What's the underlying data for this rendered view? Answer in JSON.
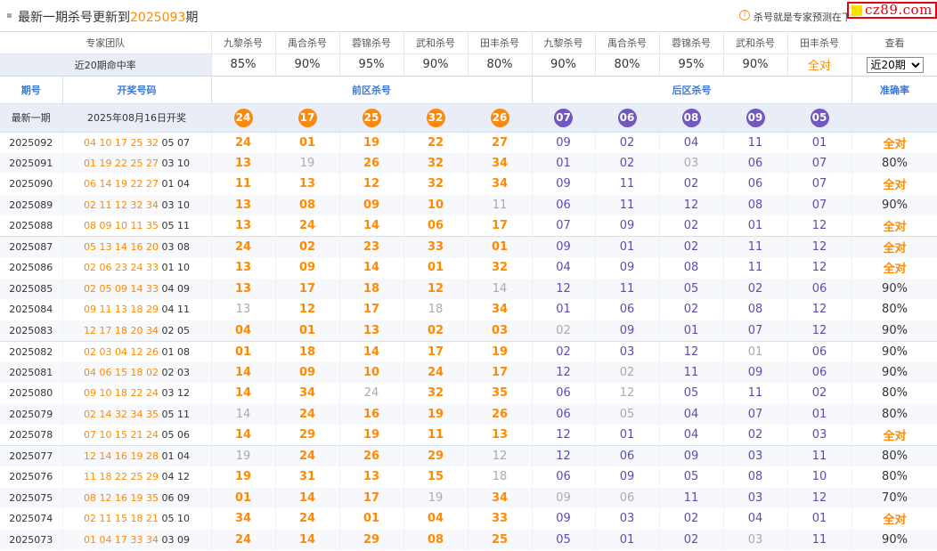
{
  "header": {
    "title_prefix": "最新一期杀号更新到",
    "title_issue": "2025093",
    "title_suffix": "期",
    "help_icon": "question-circle-icon",
    "note": "杀号就是专家预测在下",
    "logo": "cz89.com"
  },
  "experts": [
    "九黎杀号",
    "禹合杀号",
    "蓉锦杀号",
    "武和杀号",
    "田丰杀号",
    "九黎杀号",
    "禹合杀号",
    "蓉锦杀号",
    "武和杀号",
    "田丰杀号"
  ],
  "labels": {
    "team": "专家团队",
    "view": "查看",
    "rate_label": "近20期命中率",
    "col_issue": "期号",
    "col_draw": "开奖号码",
    "col_front": "前区杀号",
    "col_back": "后区杀号",
    "col_acc": "准确率"
  },
  "rates": [
    "85%",
    "90%",
    "95%",
    "90%",
    "80%",
    "90%",
    "80%",
    "95%",
    "90%",
    "全对"
  ],
  "period_select": {
    "selected": "近20期",
    "options": [
      "近20期"
    ]
  },
  "latest": {
    "issue": "最新一期",
    "draw_text": "2025年08月16日开奖",
    "front": [
      "24",
      "17",
      "25",
      "32",
      "26"
    ],
    "back": [
      "07",
      "06",
      "08",
      "09",
      "05"
    ]
  },
  "rows": [
    {
      "issue": "2025092",
      "draw_front": "04 10 17 25 32",
      "draw_back": "05 07",
      "kills": [
        "24",
        "01",
        "19",
        "22",
        "27",
        "09",
        "02",
        "04",
        "11",
        "01"
      ],
      "miss": [
        false,
        false,
        false,
        false,
        false,
        false,
        false,
        false,
        false,
        false
      ],
      "acc": "全对"
    },
    {
      "issue": "2025091",
      "draw_front": "01 19 22 25 27",
      "draw_back": "03 10",
      "kills": [
        "13",
        "19",
        "26",
        "32",
        "34",
        "01",
        "02",
        "03",
        "06",
        "07"
      ],
      "miss": [
        false,
        true,
        false,
        false,
        false,
        false,
        false,
        true,
        false,
        false
      ],
      "acc": "80%"
    },
    {
      "issue": "2025090",
      "draw_front": "06 14 19 22 27",
      "draw_back": "01 04",
      "kills": [
        "11",
        "13",
        "12",
        "32",
        "34",
        "09",
        "11",
        "02",
        "06",
        "07"
      ],
      "miss": [
        false,
        false,
        false,
        false,
        false,
        false,
        false,
        false,
        false,
        false
      ],
      "acc": "全对"
    },
    {
      "issue": "2025089",
      "draw_front": "02 11 12 32 34",
      "draw_back": "03 10",
      "kills": [
        "13",
        "08",
        "09",
        "10",
        "11",
        "06",
        "11",
        "12",
        "08",
        "07"
      ],
      "miss": [
        false,
        false,
        false,
        false,
        true,
        false,
        false,
        false,
        false,
        false
      ],
      "acc": "90%"
    },
    {
      "issue": "2025088",
      "draw_front": "08 09 10 11 35",
      "draw_back": "05 11",
      "kills": [
        "13",
        "24",
        "14",
        "06",
        "17",
        "07",
        "09",
        "02",
        "01",
        "12"
      ],
      "miss": [
        false,
        false,
        false,
        false,
        false,
        false,
        false,
        false,
        false,
        false
      ],
      "acc": "全对"
    },
    {
      "issue": "2025087",
      "draw_front": "05 13 14 16 20",
      "draw_back": "03 08",
      "kills": [
        "24",
        "02",
        "23",
        "33",
        "01",
        "09",
        "01",
        "02",
        "11",
        "12"
      ],
      "miss": [
        false,
        false,
        false,
        false,
        false,
        false,
        false,
        false,
        false,
        false
      ],
      "acc": "全对"
    },
    {
      "issue": "2025086",
      "draw_front": "02 06 23 24 33",
      "draw_back": "01 10",
      "kills": [
        "13",
        "09",
        "14",
        "01",
        "32",
        "04",
        "09",
        "08",
        "11",
        "12"
      ],
      "miss": [
        false,
        false,
        false,
        false,
        false,
        false,
        false,
        false,
        false,
        false
      ],
      "acc": "全对"
    },
    {
      "issue": "2025085",
      "draw_front": "02 05 09 14 33",
      "draw_back": "04 09",
      "kills": [
        "13",
        "17",
        "18",
        "12",
        "14",
        "12",
        "11",
        "05",
        "02",
        "06"
      ],
      "miss": [
        false,
        false,
        false,
        false,
        true,
        false,
        false,
        false,
        false,
        false
      ],
      "acc": "90%"
    },
    {
      "issue": "2025084",
      "draw_front": "09 11 13 18 29",
      "draw_back": "04 11",
      "kills": [
        "13",
        "12",
        "17",
        "18",
        "34",
        "01",
        "06",
        "02",
        "08",
        "12"
      ],
      "miss": [
        true,
        false,
        false,
        true,
        false,
        false,
        false,
        false,
        false,
        false
      ],
      "acc": "80%"
    },
    {
      "issue": "2025083",
      "draw_front": "12 17 18 20 34",
      "draw_back": "02 05",
      "kills": [
        "04",
        "01",
        "13",
        "02",
        "03",
        "02",
        "09",
        "01",
        "07",
        "12"
      ],
      "miss": [
        false,
        false,
        false,
        false,
        false,
        true,
        false,
        false,
        false,
        false
      ],
      "acc": "90%"
    },
    {
      "issue": "2025082",
      "draw_front": "02 03 04 12 26",
      "draw_back": "01 08",
      "kills": [
        "01",
        "18",
        "14",
        "17",
        "19",
        "02",
        "03",
        "12",
        "01",
        "06"
      ],
      "miss": [
        false,
        false,
        false,
        false,
        false,
        false,
        false,
        false,
        true,
        false
      ],
      "acc": "90%"
    },
    {
      "issue": "2025081",
      "draw_front": "04 06 15 18 02",
      "draw_back": "02 03",
      "kills": [
        "14",
        "09",
        "10",
        "24",
        "17",
        "12",
        "02",
        "11",
        "09",
        "06"
      ],
      "miss": [
        false,
        false,
        false,
        false,
        false,
        false,
        true,
        false,
        false,
        false
      ],
      "acc": "90%"
    },
    {
      "issue": "2025080",
      "draw_front": "09 10 18 22 24",
      "draw_back": "03 12",
      "kills": [
        "14",
        "34",
        "24",
        "32",
        "35",
        "06",
        "12",
        "05",
        "11",
        "02"
      ],
      "miss": [
        false,
        false,
        true,
        false,
        false,
        false,
        true,
        false,
        false,
        false
      ],
      "acc": "80%"
    },
    {
      "issue": "2025079",
      "draw_front": "02 14 32 34 35",
      "draw_back": "05 11",
      "kills": [
        "14",
        "24",
        "16",
        "19",
        "26",
        "06",
        "05",
        "04",
        "07",
        "01"
      ],
      "miss": [
        true,
        false,
        false,
        false,
        false,
        false,
        true,
        false,
        false,
        false
      ],
      "acc": "80%"
    },
    {
      "issue": "2025078",
      "draw_front": "07 10 15 21 24",
      "draw_back": "05 06",
      "kills": [
        "14",
        "29",
        "19",
        "11",
        "13",
        "12",
        "01",
        "04",
        "02",
        "03"
      ],
      "miss": [
        false,
        false,
        false,
        false,
        false,
        false,
        false,
        false,
        false,
        false
      ],
      "acc": "全对"
    },
    {
      "issue": "2025077",
      "draw_front": "12 14 16 19 28",
      "draw_back": "01 04",
      "kills": [
        "19",
        "24",
        "26",
        "29",
        "12",
        "12",
        "06",
        "09",
        "03",
        "11"
      ],
      "miss": [
        true,
        false,
        false,
        false,
        true,
        false,
        false,
        false,
        false,
        false
      ],
      "acc": "80%"
    },
    {
      "issue": "2025076",
      "draw_front": "11 18 22 25 29",
      "draw_back": "04 12",
      "kills": [
        "19",
        "31",
        "13",
        "15",
        "18",
        "06",
        "09",
        "05",
        "08",
        "10"
      ],
      "miss": [
        false,
        false,
        false,
        false,
        true,
        false,
        false,
        false,
        false,
        false
      ],
      "acc": "80%"
    },
    {
      "issue": "2025075",
      "draw_front": "08 12 16 19 35",
      "draw_back": "06 09",
      "kills": [
        "01",
        "14",
        "17",
        "19",
        "34",
        "09",
        "06",
        "11",
        "03",
        "12"
      ],
      "miss": [
        false,
        false,
        false,
        true,
        false,
        true,
        true,
        false,
        false,
        false
      ],
      "acc": "70%"
    },
    {
      "issue": "2025074",
      "draw_front": "02 11 15 18 21",
      "draw_back": "05 10",
      "kills": [
        "34",
        "24",
        "01",
        "04",
        "33",
        "09",
        "03",
        "02",
        "04",
        "01"
      ],
      "miss": [
        false,
        false,
        false,
        false,
        false,
        false,
        false,
        false,
        false,
        false
      ],
      "acc": "全对"
    },
    {
      "issue": "2025073",
      "draw_front": "01 04 17 33 34",
      "draw_back": "03 09",
      "kills": [
        "24",
        "14",
        "29",
        "08",
        "25",
        "05",
        "01",
        "02",
        "03",
        "11"
      ],
      "miss": [
        false,
        false,
        false,
        false,
        false,
        false,
        false,
        false,
        true,
        false
      ],
      "acc": "90%"
    }
  ]
}
